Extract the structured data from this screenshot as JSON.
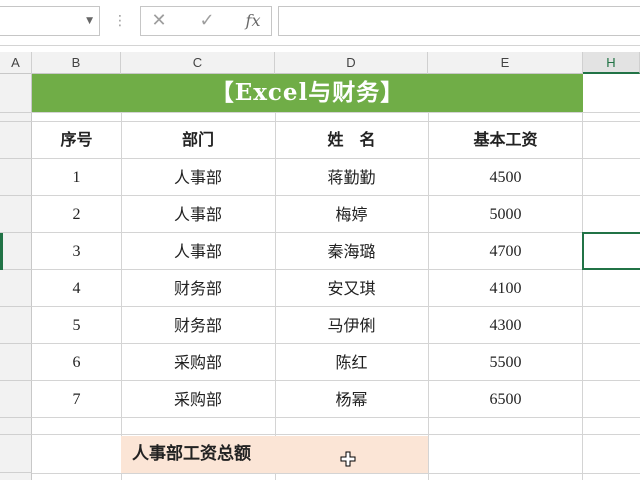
{
  "formula_bar": {
    "cancel_icon": "✕",
    "enter_icon": "✓",
    "fx_label": "fx",
    "formula_value": ""
  },
  "columns": [
    "A",
    "B",
    "C",
    "D",
    "E",
    "H"
  ],
  "title": "【Excel与财务】",
  "table": {
    "headers": [
      "序号",
      "部门",
      "姓　名",
      "基本工资"
    ],
    "rows": [
      [
        "1",
        "人事部",
        "蒋勤勤",
        "4500"
      ],
      [
        "2",
        "人事部",
        "梅婷",
        "5000"
      ],
      [
        "3",
        "人事部",
        "秦海璐",
        "4700"
      ],
      [
        "4",
        "财务部",
        "安又琪",
        "4100"
      ],
      [
        "5",
        "财务部",
        "马伊俐",
        "4300"
      ],
      [
        "6",
        "采购部",
        "陈红",
        "5500"
      ],
      [
        "7",
        "采购部",
        "杨幂",
        "6500"
      ]
    ]
  },
  "summary": {
    "label": "人事部工资总额",
    "value": ""
  },
  "colors": {
    "title_bg": "#70ad47",
    "summary_bg": "#fbe5d6",
    "selection": "#217346"
  },
  "active_cell_column": "H"
}
